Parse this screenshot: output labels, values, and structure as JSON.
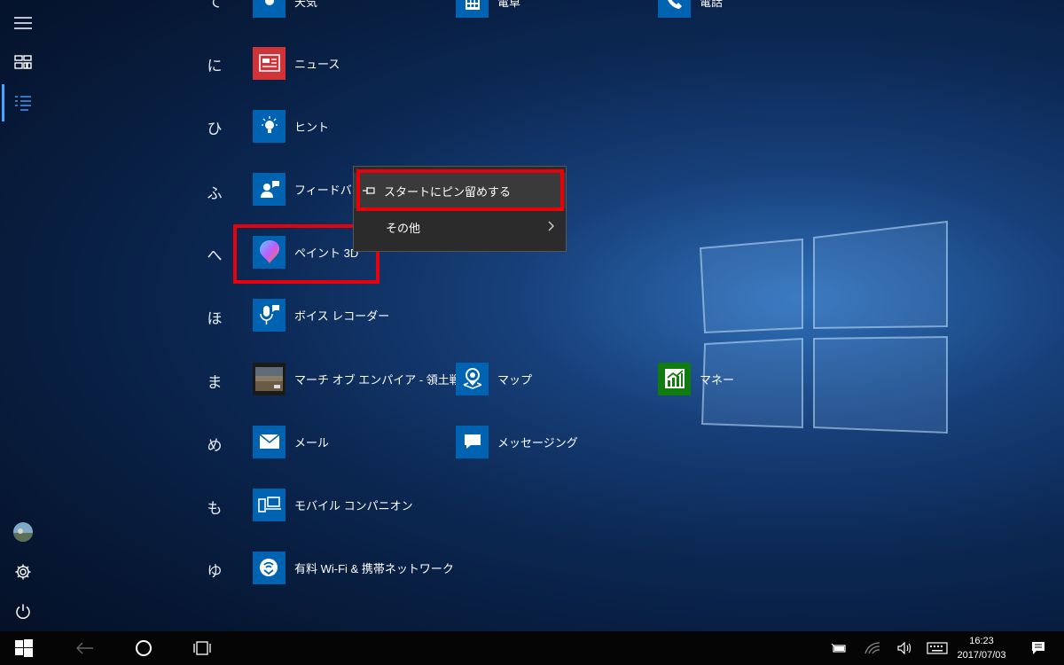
{
  "letters": {
    "te": "て",
    "ni": "に",
    "hi": "ひ",
    "fu": "ふ",
    "he": "へ",
    "ho": "ほ",
    "ma": "ま",
    "me": "め",
    "mo": "も",
    "yu": "ゆ"
  },
  "apps": {
    "weather": "天気",
    "calculator": "電卓",
    "phone": "電話",
    "news": "ニュース",
    "tips": "ヒント",
    "feedback": "フィードバック",
    "paint3d": "ペイント 3D",
    "voice_recorder": "ボイス レコーダー",
    "march_of_empires": "マーチ オブ エンパイア - 領土戦…",
    "maps": "マップ",
    "money": "マネー",
    "mail": "メール",
    "messaging": "メッセージング",
    "mobile_companion": "モバイル コンパニオン",
    "paid_wifi": "有料 Wi-Fi & 携帯ネットワーク"
  },
  "context_menu": {
    "pin_to_start": "スタートにピン留めする",
    "more": "その他"
  },
  "taskbar": {
    "time": "16:23",
    "date": "2017/07/03"
  },
  "colors": {
    "tile_blue": "#0063b1",
    "news_red": "#d13438",
    "money_green": "#107c10",
    "highlight_red": "#e8000b",
    "accent": "#4aa3ff"
  }
}
